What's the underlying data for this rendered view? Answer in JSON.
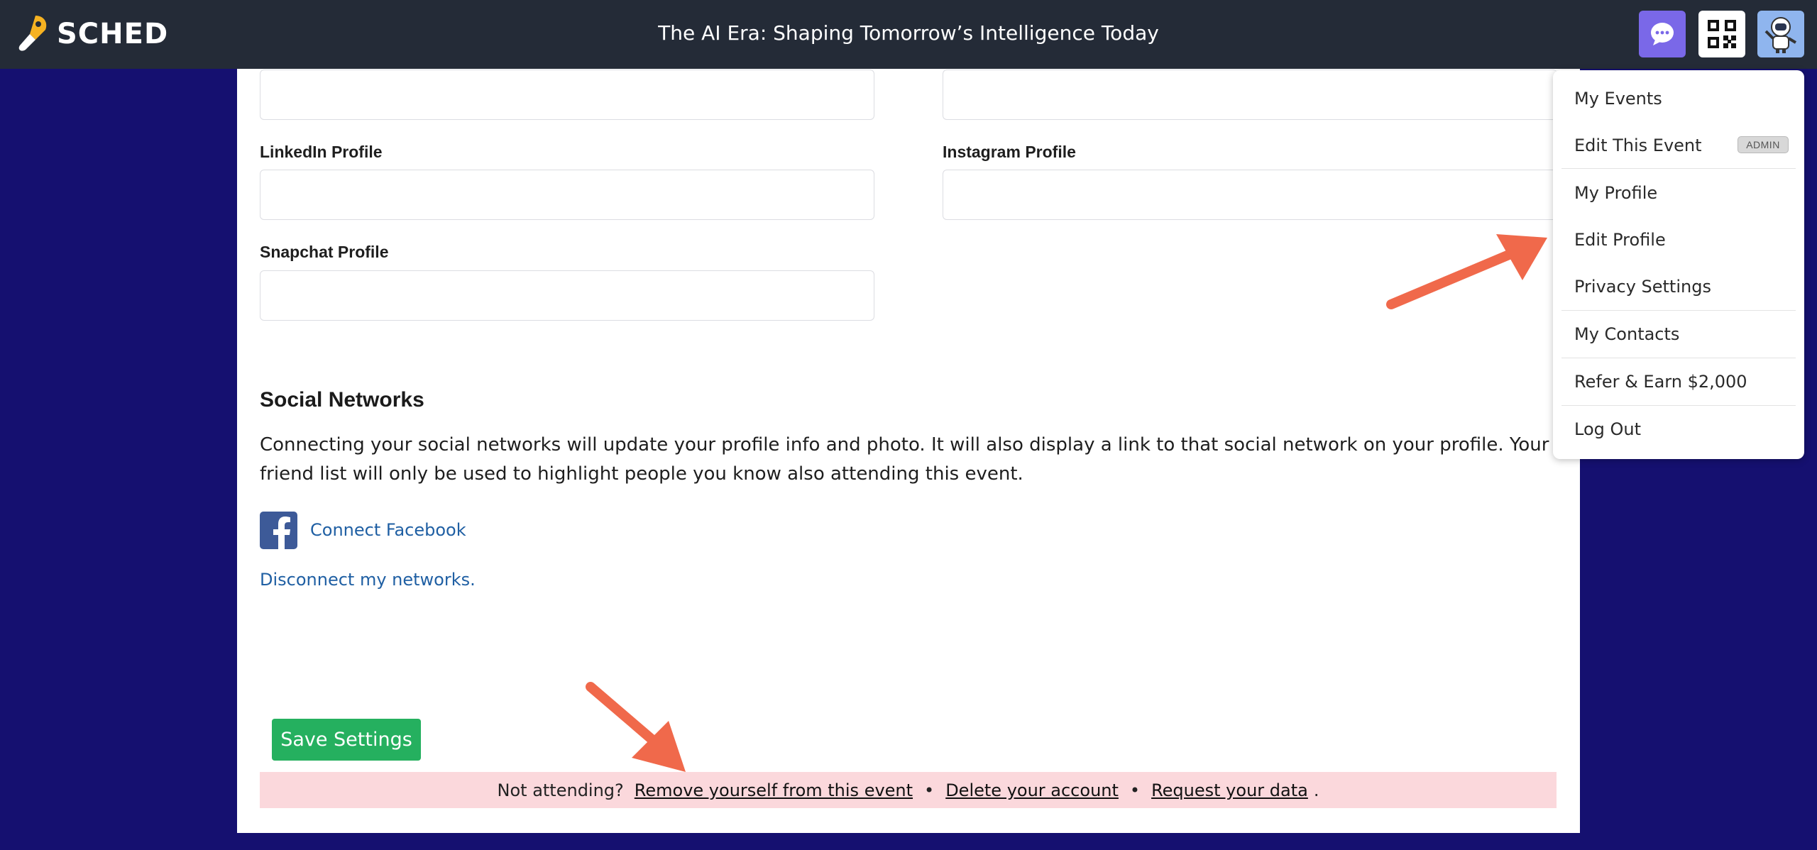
{
  "topbar": {
    "logo_text": "SCHED",
    "event_title": "The AI Era: Shaping Tomorrow’s Intelligence Today"
  },
  "form": {
    "linkedin_label": "LinkedIn Profile",
    "instagram_label": "Instagram Profile",
    "snapchat_label": "Snapchat Profile"
  },
  "social": {
    "title": "Social Networks",
    "description": "Connecting your social networks will update your profile info and photo. It will also display a link to that social network on your profile. Your friend list will only be used to highlight people you know also attending this event.",
    "connect_facebook": "Connect Facebook",
    "disconnect": "Disconnect my networks."
  },
  "save_label": "Save Settings",
  "notice": {
    "question": "Not attending?",
    "remove": "Remove yourself from this event",
    "bullet": "•",
    "delete": "Delete your account",
    "request": "Request your data",
    "end": "."
  },
  "menu": {
    "items": [
      "My Events",
      "Edit This Event",
      "My Profile",
      "Edit Profile",
      "Privacy Settings",
      "My Contacts",
      "Refer & Earn $2,000",
      "Log Out"
    ],
    "admin_badge": "ADMIN"
  },
  "colors": {
    "background": "#151070",
    "topbar": "#242b37",
    "save_button": "#25b05f",
    "link": "#1f5fa3",
    "notice_bg": "#fbd8dc",
    "arrow": "#f0694b"
  }
}
